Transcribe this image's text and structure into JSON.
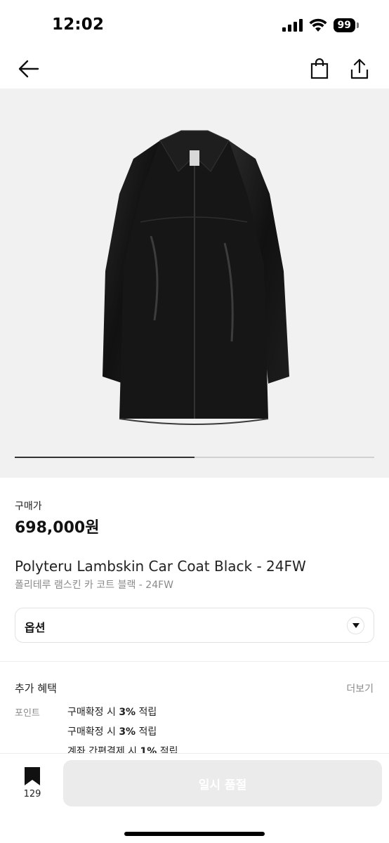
{
  "status_bar": {
    "time": "12:02",
    "battery": "99",
    "icons": [
      "cellular-signal-icon",
      "wifi-icon",
      "battery-icon"
    ]
  },
  "nav": {
    "icons": [
      "back-arrow-icon",
      "shopping-bag-icon",
      "share-icon"
    ]
  },
  "carousel": {
    "progress": 0.5
  },
  "product": {
    "price_label": "구매가",
    "price": "698,000원",
    "title_en": "Polyteru Lambskin Car Coat Black - 24FW",
    "title_ko": "폴리테루 램스킨 카 코트 블랙 - 24FW"
  },
  "option": {
    "label": "옵션",
    "icon": "chevron-down-icon"
  },
  "benefits": {
    "title": "추가 혜택",
    "more": "더보기",
    "point_label": "포인트",
    "lines": [
      {
        "prefix": "구매확정 시 ",
        "rate": "3%",
        "suffix": " 적립"
      },
      {
        "prefix": "구매확정 시 ",
        "rate": "3%",
        "suffix": " 적립"
      },
      {
        "prefix": "계좌 간편결제 시 ",
        "rate": "1%",
        "suffix": " 적립"
      }
    ]
  },
  "bottom_bar": {
    "wish_count": "129",
    "icon": "bookmark-icon",
    "button_label": "일시 품절"
  },
  "colors": {
    "button_disabled": "#ebebeb",
    "image_bg": "#f1f1f1",
    "coat": "#141414"
  }
}
